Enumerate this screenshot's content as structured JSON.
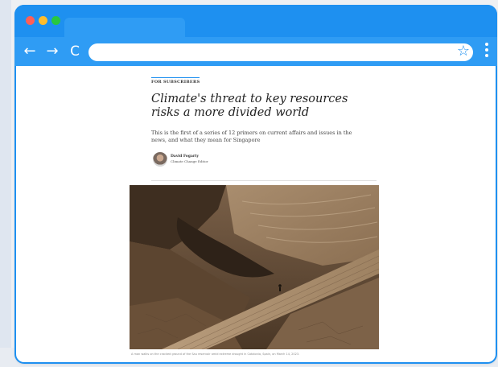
{
  "browser": {
    "address_value": "",
    "star_glyph": "☆",
    "back_glyph": "←",
    "forward_glyph": "→",
    "reload_glyph": "C"
  },
  "article": {
    "kicker": "FOR SUBSCRIBERS",
    "headline": "Climate's threat to key resources risks a more divided world",
    "standfirst": "This is the first of a series of 12 primers on current affairs and issues in the news, and what they mean for Singapore",
    "author_name": "David Fogarty",
    "author_role": "Climate Change Editor",
    "caption": "A man walks on the cracked ground of the Sau reservoir amid extreme drought in Catalonia, Spain, on March 14, 2023."
  },
  "colors": {
    "browser_blue": "#1e90f0",
    "toolbar_blue": "#2f9cf4",
    "close_red": "#ff5f57",
    "min_yellow": "#ffbd2e",
    "max_green": "#28c840"
  }
}
